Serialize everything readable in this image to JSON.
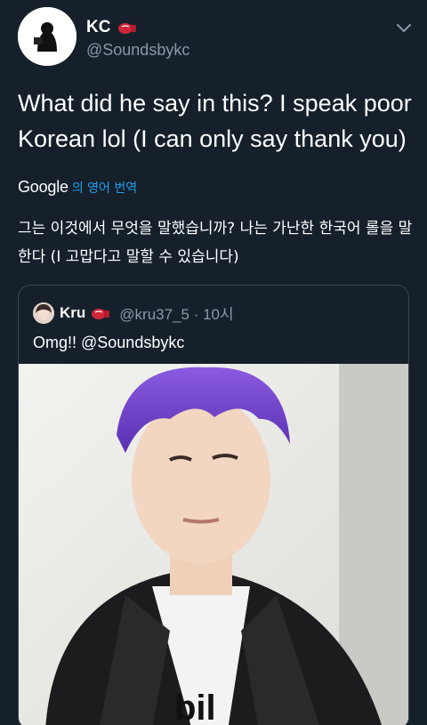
{
  "tweet": {
    "author_name": "KC",
    "author_handle": "@Soundsbykc",
    "text": "What did he say in this? I speak poor Korean lol (I can only say thank you)"
  },
  "translation": {
    "logo": "Google",
    "label": "의 영어 번역",
    "text": "그는 이것에서 무엇을 말했습니까? 나는 가난한 한국어 롤을 말한다 (I 고맙다고 말할 수 있습니다)"
  },
  "quoted_tweet": {
    "author_name": "Kru",
    "author_handle": "@kru37_5 · 10시",
    "text": "Omg!! @Soundsbykc"
  },
  "icons": {
    "boxing_glove": "boxing-glove-emoji",
    "more": "chevron-down-icon"
  },
  "colors": {
    "background": "#15202b",
    "secondary_text": "#8899a6",
    "link": "#1da1f2",
    "border": "#38444d"
  }
}
